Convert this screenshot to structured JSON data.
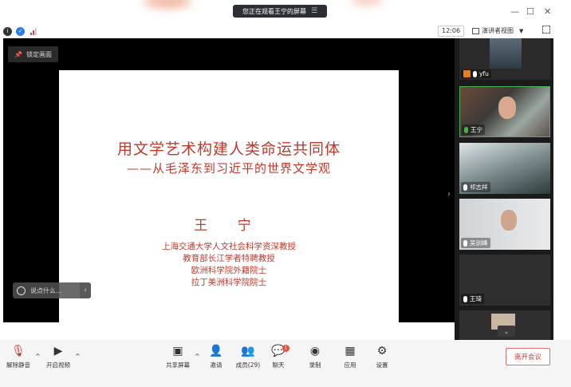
{
  "screen_share_banner": "您正在观看王宁的屏幕",
  "time": "12:06",
  "view_selector": "演讲者视图",
  "lock_screen_label": "锁定画面",
  "slide": {
    "title": "用文学艺术构建人类命运共同体",
    "subtitle": "——从毛泽东到习近平的世界文学观",
    "author": "王 宁",
    "affiliations": [
      "上海交通大学人文社会科学资深教授",
      "教育部长江学者特聘教授",
      "欧洲科学院外籍院士",
      "拉丁美洲科学院院士"
    ]
  },
  "chat_input_placeholder": "说点什么...",
  "participants": [
    "yfu",
    "王宁",
    "祁志祥",
    "吴剑峰",
    "王琦"
  ],
  "toolbar": {
    "unmute": "解除静音",
    "start_video": "开启视频",
    "share_screen": "共享屏幕",
    "invite": "邀请",
    "members": "成员(29)",
    "chat": "聊天",
    "chat_badge": "1",
    "record": "录制",
    "apps": "应用",
    "settings": "设置",
    "leave": "离开会议"
  },
  "colors": {
    "slide_text": "#c0392b",
    "leave": "#d43c3c",
    "mic_active": "#4caf50"
  }
}
